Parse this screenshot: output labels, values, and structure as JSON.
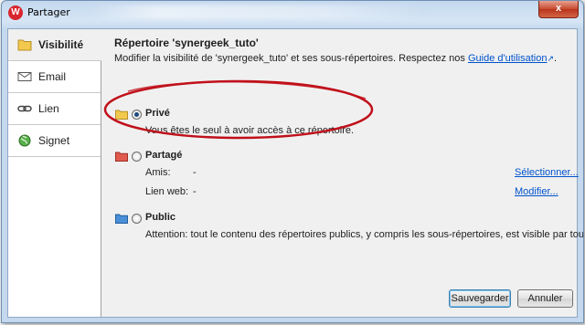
{
  "window": {
    "title": "Partager",
    "logo_letter": "W",
    "close_label": "x"
  },
  "sidebar": {
    "items": [
      {
        "label": "Visibilité",
        "icon": "folder-icon",
        "active": true
      },
      {
        "label": "Email",
        "icon": "envelope-icon",
        "active": false
      },
      {
        "label": "Lien",
        "icon": "chain-link-icon",
        "active": false
      },
      {
        "label": "Signet",
        "icon": "globe-icon",
        "active": false
      }
    ]
  },
  "main": {
    "heading": "Répertoire 'synergeek_tuto'",
    "description_prefix": "Modifier la visibilité de 'synergeek_tuto' et ses sous-répertoires. Respectez nos ",
    "guide_link": "Guide d'utilisation",
    "external_mark": "↗",
    "description_suffix": ".",
    "options": {
      "prive": {
        "label": "Privé",
        "selected": true,
        "text": "Vous êtes le seul à avoir accès à ce répertoire."
      },
      "partage": {
        "label": "Partagé",
        "selected": false,
        "amis_label": "Amis:",
        "amis_value": "-",
        "lienweb_label": "Lien web:",
        "lienweb_value": "-",
        "select_link": "Sélectionner...",
        "modify_link": "Modifier..."
      },
      "public": {
        "label": "Public",
        "selected": false,
        "text": "Attention: tout le contenu des répertoires publics, y compris les sous-répertoires, est visible par tous."
      }
    },
    "buttons": {
      "save": "Sauvegarder",
      "cancel": "Annuler"
    }
  },
  "colors": {
    "accent_link": "#0052cc",
    "highlight_oval": "#c0101a",
    "folder_private": "#f2c94c",
    "folder_shared": "#e05a4f",
    "folder_public": "#4a90d9"
  }
}
